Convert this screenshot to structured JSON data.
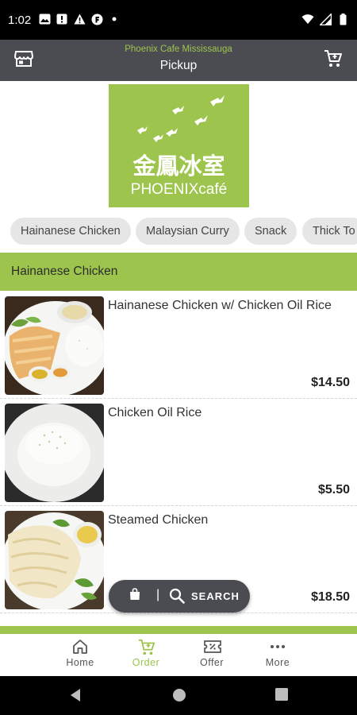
{
  "status_bar": {
    "time": "1:02",
    "left_icons": [
      "gallery-icon",
      "alert-icon",
      "warning-icon",
      "app-icon",
      "dot-icon"
    ],
    "right_icons": [
      "wifi-icon",
      "signal-icon",
      "battery-icon"
    ]
  },
  "header": {
    "store_name": "Phoenix Cafe Mississauga",
    "mode": "Pickup",
    "left_icon": "store-icon",
    "right_icon": "cart-icon"
  },
  "logo": {
    "chinese_text": "金鳳冰室",
    "brand_text": "PHOENIXcafé"
  },
  "categories": [
    {
      "label": "Hainanese Chicken"
    },
    {
      "label": "Malaysian Curry"
    },
    {
      "label": "Snack"
    },
    {
      "label": "Thick To"
    }
  ],
  "section": {
    "title": "Hainanese Chicken"
  },
  "menu_items": [
    {
      "name": "Hainanese Chicken w/ Chicken Oil Rice",
      "price": "$14.50"
    },
    {
      "name": "Chicken Oil Rice",
      "price": "$5.50"
    },
    {
      "name": "Steamed Chicken",
      "price": "$18.50"
    }
  ],
  "float_bar": {
    "separator": "|",
    "search_label": "SEARCH"
  },
  "bottom_nav": [
    {
      "label": "Home",
      "icon": "home-icon"
    },
    {
      "label": "Order",
      "icon": "order-cart-icon"
    },
    {
      "label": "Offer",
      "icon": "offer-ticket-icon"
    },
    {
      "label": "More",
      "icon": "more-dots-icon"
    }
  ],
  "colors": {
    "brand_green": "#9dc44d",
    "header_gray": "#4a4c52",
    "chip_gray": "#e6e6e6"
  }
}
